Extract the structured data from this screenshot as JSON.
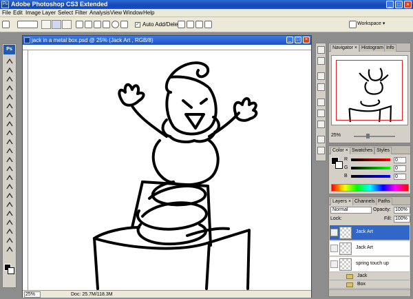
{
  "app": {
    "title": "Adobe Photoshop CS3 Extended",
    "badge": "Ps"
  },
  "window_controls": {
    "minimize": "_",
    "maximize": "□",
    "close": "×"
  },
  "menu": [
    "File",
    "Edit",
    "Image",
    "Layer",
    "Select",
    "Filter",
    "Analysis",
    "View",
    "Window",
    "Help"
  ],
  "options": {
    "auto_add_delete": "Auto Add/Delete",
    "auto_add_delete_checked": true,
    "workspace": "Workspace ▾"
  },
  "toolbox": {
    "logo": "Ps",
    "tools": [
      "move-tool",
      "marquee-tool",
      "lasso-tool",
      "magic-wand-tool",
      "crop-tool",
      "slice-tool",
      "healing-brush-tool",
      "brush-tool",
      "clone-stamp-tool",
      "history-brush-tool",
      "eraser-tool",
      "gradient-tool",
      "blur-tool",
      "dodge-tool",
      "pen-tool",
      "type-tool",
      "path-selection-tool",
      "shape-tool",
      "notes-tool",
      "eyedropper-tool",
      "hand-tool",
      "zoom-tool"
    ],
    "foreground_color": "#000000",
    "background_color": "#ffffff"
  },
  "document": {
    "title": "jack in a metal box.psd @ 25% (Jack Art , RGB/8)",
    "zoom": "25%",
    "doc_size": "Doc: 25.7M/118.3M"
  },
  "navigator": {
    "tabs": [
      "Navigator ×",
      "Histogram",
      "Info"
    ],
    "zoom": "25%"
  },
  "color_panel": {
    "tabs": [
      "Color ×",
      "Swatches",
      "Styles"
    ],
    "channels": [
      {
        "label": "R",
        "value": "0",
        "gradient": "linear-gradient(90deg,#000,#ff0000)"
      },
      {
        "label": "G",
        "value": "0",
        "gradient": "linear-gradient(90deg,#000,#00ff00)"
      },
      {
        "label": "B",
        "value": "0",
        "gradient": "linear-gradient(90deg,#000,#0000ff)"
      }
    ]
  },
  "layers_panel": {
    "tabs": [
      "Layers ×",
      "Channels",
      "Paths"
    ],
    "blend_mode": "Normal",
    "opacity_label": "Opacity:",
    "opacity": "100%",
    "lock_label": "Lock:",
    "fill_label": "Fill:",
    "fill": "100%",
    "layers": [
      {
        "name": "Jack Art",
        "selected": true
      },
      {
        "name": "Jack Art",
        "selected": false
      },
      {
        "name": "spring touch up",
        "selected": false
      }
    ],
    "groups": [
      "Jack",
      "Box"
    ]
  },
  "colors": {
    "titlebar": "#1446b8",
    "selection": "#3167c7",
    "nav_view_box": "#e02020"
  }
}
